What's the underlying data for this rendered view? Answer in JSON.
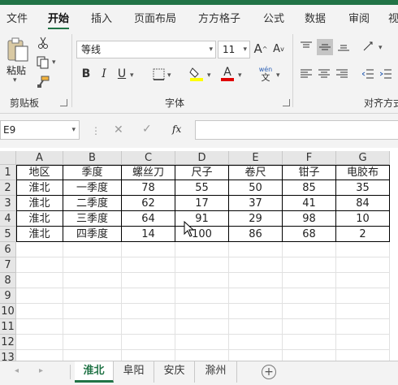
{
  "ribbon_tabs": [
    {
      "label": "文件",
      "active": false
    },
    {
      "label": "开始",
      "active": true
    },
    {
      "label": "插入",
      "active": false
    },
    {
      "label": "页面布局",
      "active": false
    },
    {
      "label": "方方格子",
      "active": false
    },
    {
      "label": "公式",
      "active": false
    },
    {
      "label": "数据",
      "active": false
    },
    {
      "label": "审阅",
      "active": false
    },
    {
      "label": "视",
      "active": false
    }
  ],
  "clipboard": {
    "paste_label": "粘贴",
    "group_label": "剪贴板"
  },
  "font": {
    "name": "等线",
    "size": "11",
    "group_label": "字体",
    "bold": "B",
    "italic": "I",
    "underline": "U",
    "wen": "wén",
    "wen_char": "文",
    "grow": "A",
    "shrink": "A"
  },
  "alignment": {
    "group_label": "对齐方式"
  },
  "formula_bar": {
    "name_box": "E9",
    "fx": "fx",
    "value": ""
  },
  "columns": [
    "A",
    "B",
    "C",
    "D",
    "E",
    "F",
    "G"
  ],
  "rows": [
    "1",
    "2",
    "3",
    "4",
    "5",
    "6",
    "7",
    "8",
    "9",
    "10",
    "11",
    "12",
    "13"
  ],
  "cells": [
    [
      "地区",
      "季度",
      "螺丝刀",
      "尺子",
      "卷尺",
      "钳子",
      "电胶布"
    ],
    [
      "淮北",
      "一季度",
      "78",
      "55",
      "50",
      "85",
      "35"
    ],
    [
      "淮北",
      "二季度",
      "62",
      "17",
      "37",
      "41",
      "84"
    ],
    [
      "淮北",
      "三季度",
      "64",
      "91",
      "29",
      "98",
      "10"
    ],
    [
      "淮北",
      "四季度",
      "14",
      "100",
      "86",
      "68",
      "2"
    ]
  ],
  "sheet_tabs": [
    "淮北",
    "阜阳",
    "安庆",
    "滁州"
  ],
  "active_sheet": "淮北",
  "colors": {
    "accent": "#217346",
    "font_color": "#e00000",
    "highlight": "#ffff00"
  }
}
